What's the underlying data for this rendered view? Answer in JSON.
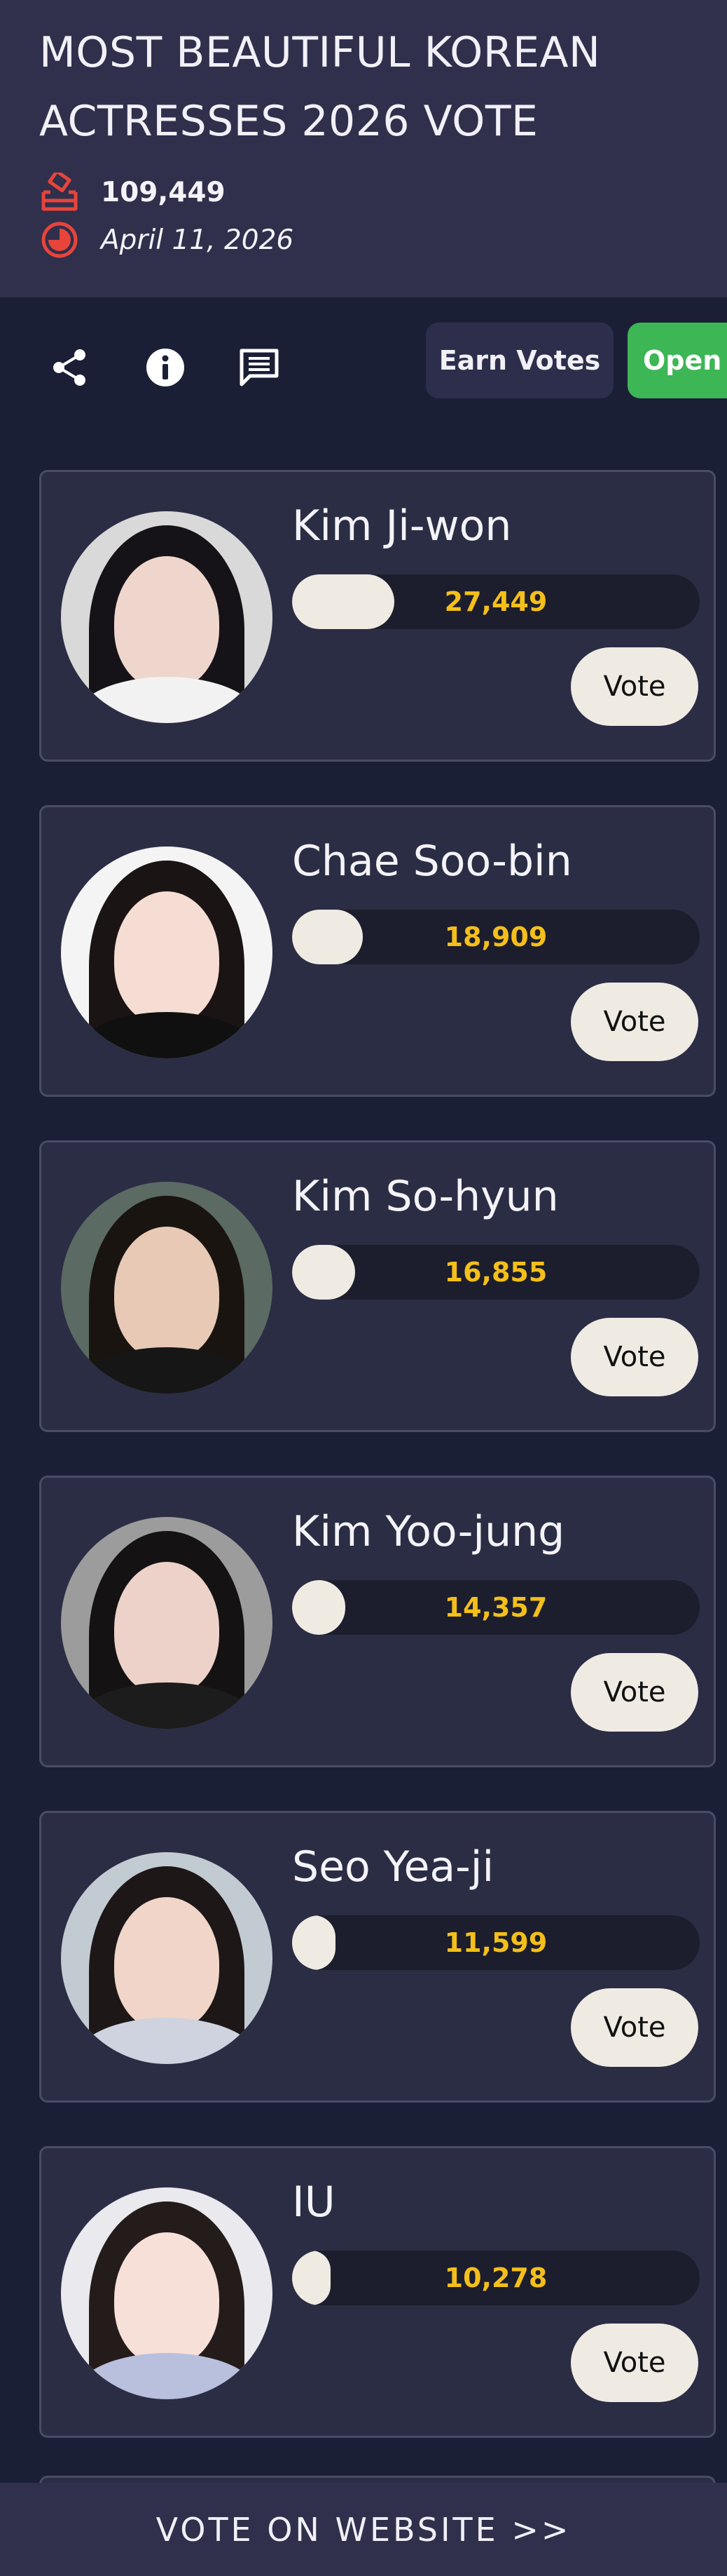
{
  "header": {
    "title": "MOST BEAUTIFUL KOREAN ACTRESSES 2026 VOTE",
    "total_votes": "109,449",
    "date": "April 11, 2026",
    "votes_icon": "ballot-box-icon",
    "date_icon": "clock-icon",
    "icon_color": "#e8443a"
  },
  "toolbar": {
    "icons": [
      "share-icon",
      "info-icon",
      "comment-icon"
    ],
    "earn_label": "Earn Votes",
    "open_label": "Open"
  },
  "colors": {
    "background": "#1a1f36",
    "header_bg": "#302f4c",
    "card_bg": "#2b2d45",
    "vote_count": "#f4bf1a",
    "button_bg": "#efebe3",
    "open_green": "#3db655"
  },
  "candidates": [
    {
      "name": "Kim Ji-won",
      "votes": "27,449",
      "share": 0.251,
      "vote_label": "Vote"
    },
    {
      "name": "Chae Soo-bin",
      "votes": "18,909",
      "share": 0.173,
      "vote_label": "Vote"
    },
    {
      "name": "Kim So-hyun",
      "votes": "16,855",
      "share": 0.154,
      "vote_label": "Vote"
    },
    {
      "name": "Kim Yoo-jung",
      "votes": "14,357",
      "share": 0.131,
      "vote_label": "Vote"
    },
    {
      "name": "Seo Yea-ji",
      "votes": "11,599",
      "share": 0.106,
      "vote_label": "Vote"
    },
    {
      "name": "IU",
      "votes": "10,278",
      "share": 0.094,
      "vote_label": "Vote"
    }
  ],
  "footer": {
    "banner_label": "VOTE ON WEBSITE >>"
  }
}
